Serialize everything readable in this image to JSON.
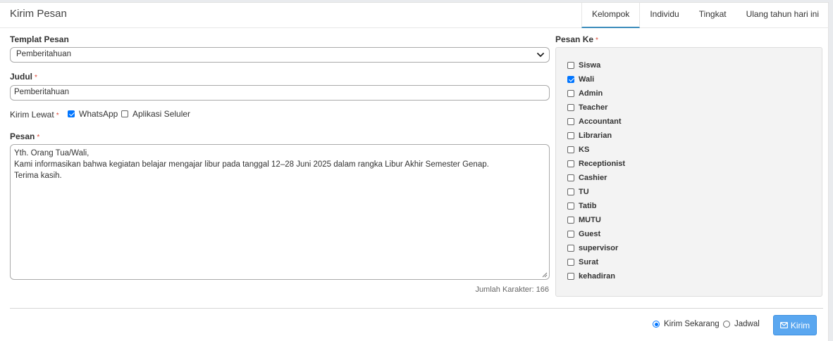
{
  "header": {
    "title": "Kirim Pesan",
    "tabs": [
      {
        "label": "Kelompok",
        "active": true
      },
      {
        "label": "Individu",
        "active": false
      },
      {
        "label": "Tingkat",
        "active": false
      },
      {
        "label": "Ulang tahun hari ini",
        "active": false
      }
    ]
  },
  "form": {
    "template_label": "Templat Pesan",
    "template_value": "Pemberitahuan",
    "title_label": "Judul",
    "title_value": "Pemberitahuan",
    "via_label": "Kirim Lewat",
    "via_options": [
      {
        "label": "WhatsApp",
        "checked": true
      },
      {
        "label": "Aplikasi Seluler",
        "checked": false
      }
    ],
    "message_label": "Pesan",
    "message_lines": [
      "Yth. Orang Tua/Wali,",
      "Kami informasikan bahwa kegiatan belajar mengajar libur pada tanggal 12–28 Juni 2025 dalam rangka Libur Akhir Semester Genap.",
      "Terima kasih."
    ],
    "char_count_text": "Jumlah Karakter: 166",
    "required_mark": "*"
  },
  "recipients": {
    "label": "Pesan Ke",
    "items": [
      {
        "label": "Siswa",
        "checked": false
      },
      {
        "label": "Wali",
        "checked": true
      },
      {
        "label": "Admin",
        "checked": false
      },
      {
        "label": "Teacher",
        "checked": false
      },
      {
        "label": "Accountant",
        "checked": false
      },
      {
        "label": "Librarian",
        "checked": false
      },
      {
        "label": "KS",
        "checked": false
      },
      {
        "label": "Receptionist",
        "checked": false
      },
      {
        "label": "Cashier",
        "checked": false
      },
      {
        "label": "TU",
        "checked": false
      },
      {
        "label": "Tatib",
        "checked": false
      },
      {
        "label": "MUTU",
        "checked": false
      },
      {
        "label": "Guest",
        "checked": false
      },
      {
        "label": "supervisor",
        "checked": false
      },
      {
        "label": "Surat",
        "checked": false
      },
      {
        "label": "kehadiran",
        "checked": false
      }
    ]
  },
  "footer": {
    "send_now_label": "Kirim Sekarang",
    "send_now_selected": true,
    "schedule_label": "Jadwal",
    "schedule_selected": false,
    "send_button_label": "Kirim",
    "send_button_icon": "envelope-icon",
    "accent_color": "#5aa7f0"
  }
}
